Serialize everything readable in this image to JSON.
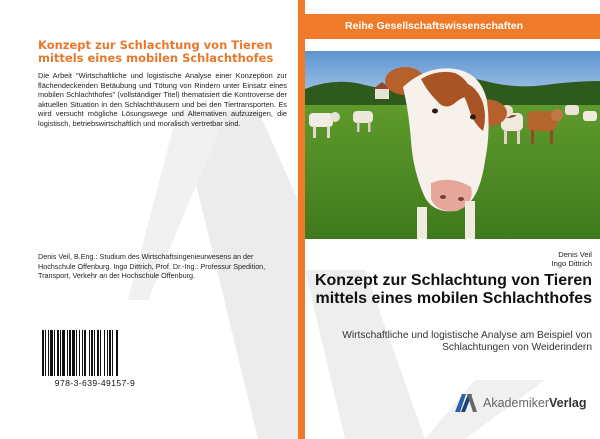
{
  "back_cover": {
    "title": "Konzept zur Schlachtung von Tieren mittels eines mobilen Schlachthofes",
    "abstract": "Die Arbeit \"Wirtschaftliche und logistische Analyse einer Konzeption zur flächendeckenden Betäubung und Tötung von Rindern unter Einsatz eines mobilen Schlachthofes\" (vollständiger Titel) thematisiert die Kontroverse der aktuellen Situation in den Schlachthäusern und bei den Tiertransporten. Es wird versucht mögliche Lösungswege und Alternativen aufzuzeigen, die logistisch, betriebswirtschaftlich und moralisch vertretbar sind.",
    "authors_bio": "Denis Veil, B.Eng.: Studium des Wirtschaftsingenieurwesens an der Hochschule Offenburg. Ingo Dittrich, Prof. Dr.-Ing.: Professur Spedition, Transport, Verkehr an der Hochschule Offenburg.",
    "isbn": "978-3-639-49157-9"
  },
  "front_cover": {
    "series": "Reihe Gesellschaftswissenschaften",
    "author1": "Denis Veil",
    "author2": "Ingo Dittrich",
    "title": "Konzept zur Schlachtung von Tieren mittels eines mobilen Schlachthofes",
    "subtitle": "Wirtschaftliche und logistische Analyse am Beispiel von Schlachtungen von Weiderindern",
    "publisher_part1": "Akademiker",
    "publisher_part2": "Verlag"
  },
  "colors": {
    "accent": "#ef7b2a",
    "title_orange": "#e8792c",
    "watermark": "#ececec"
  },
  "icons": {
    "publisher_logo": "av-logo-icon",
    "barcode": "barcode"
  }
}
